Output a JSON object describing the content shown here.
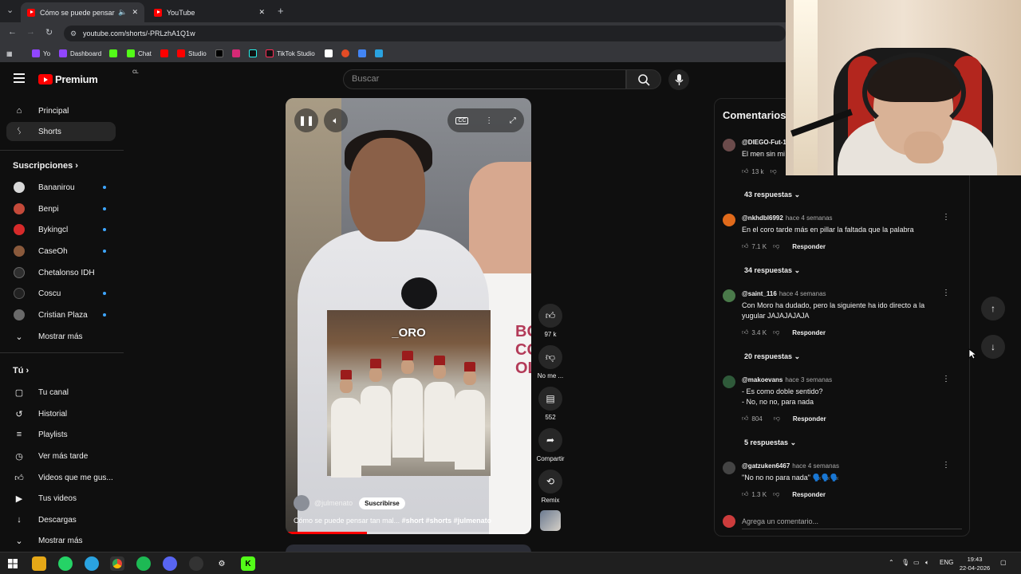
{
  "browser": {
    "tabs": [
      {
        "label": "Cómo se puede pensar tan",
        "active": true
      },
      {
        "label": "YouTube",
        "active": false
      }
    ],
    "url": "youtube.com/shorts/-PRLzhA1Q1w",
    "bookmarks": [
      "Yo",
      "Dashboard",
      "Chat",
      "Studio",
      "TikTok Studio"
    ]
  },
  "header": {
    "logo": "Premium",
    "region": "CL",
    "search_placeholder": "Buscar"
  },
  "sidebar": {
    "main": [
      {
        "label": "Principal",
        "icon": "home-icon"
      },
      {
        "label": "Shorts",
        "icon": "shorts-icon",
        "active": true
      }
    ],
    "subscriptions_heading": "Suscripciones",
    "subscriptions": [
      {
        "label": "Bananirou",
        "color": "#d8d8d8"
      },
      {
        "label": "Benpi",
        "color": "#c44a3a"
      },
      {
        "label": "Bykingcl",
        "color": "#d62a2a"
      },
      {
        "label": "CaseOh",
        "color": "#8a5a3c"
      },
      {
        "label": "Chetalonso IDH",
        "color": "#2f2f2f"
      },
      {
        "label": "Coscu",
        "color": "#222222"
      },
      {
        "label": "Cristian Plaza",
        "color": "#6a6a6a"
      }
    ],
    "show_more": "Mostrar más",
    "you_heading": "Tú",
    "you_items": [
      {
        "label": "Tu canal",
        "icon": "channel-icon"
      },
      {
        "label": "Historial",
        "icon": "history-icon"
      },
      {
        "label": "Playlists",
        "icon": "playlists-icon"
      },
      {
        "label": "Ver más tarde",
        "icon": "watch-later-icon"
      },
      {
        "label": "Videos que me gus...",
        "icon": "liked-icon"
      },
      {
        "label": "Tus videos",
        "icon": "your-videos-icon"
      },
      {
        "label": "Descargas",
        "icon": "download-icon"
      }
    ],
    "show_more_2": "Mostrar más"
  },
  "video": {
    "overlay_text": "_ORO",
    "shirt_text": "BOYS\nCOM\nOL",
    "channel": "@julmenato",
    "subscribe": "Suscribirse",
    "title_plain": "Cómo se puede pensar tan mal... ",
    "title_tags": "#short #shorts #julmenato",
    "progress": 0.33
  },
  "actions": {
    "likes": "97 k",
    "dislike": "No me ...",
    "comments": "552",
    "share": "Compartir",
    "remix": "Remix"
  },
  "comments": {
    "title": "Comentarios",
    "reply_label": "Responder",
    "items": [
      {
        "user": "@DIEGO-Fut-1",
        "time": "",
        "text": "El men sin mi",
        "likes": "13 k",
        "replies": "43 respuestas",
        "avatar": "#6b4b4b"
      },
      {
        "user": "@nkhdbl6992",
        "time": "hace 4 semanas",
        "text": "En el coro tarde más en pillar la faltada que la palabra",
        "likes": "7.1 K",
        "replies": "34 respuestas",
        "avatar": "#e06a1b"
      },
      {
        "user": "@saint_116",
        "time": "hace 4 semanas",
        "text": "Con Moro ha dudado, pero la siguiente ha ido directo a la yugular JAJAJAJAJA",
        "likes": "3.4 K",
        "replies": "20 respuestas",
        "avatar": "#4a7a4a"
      },
      {
        "user": "@makoevans",
        "time": "hace 3 semanas",
        "text": "- Es como doble sentido?\n- No, no no, para nada",
        "likes": "804",
        "replies": "5 respuestas",
        "avatar": "#2f5a3a"
      },
      {
        "user": "@gatzuken6467",
        "time": "hace 4 semanas",
        "text": "\"No no no para nada\" 🗣️🗣️🗣️",
        "likes": "1.3 K",
        "replies": "",
        "avatar": "#444444"
      }
    ],
    "add_placeholder": "Agrega un comentario..."
  },
  "taskbar": {
    "lang": "ENG",
    "time": "19:43",
    "date": "22-04-2026"
  }
}
